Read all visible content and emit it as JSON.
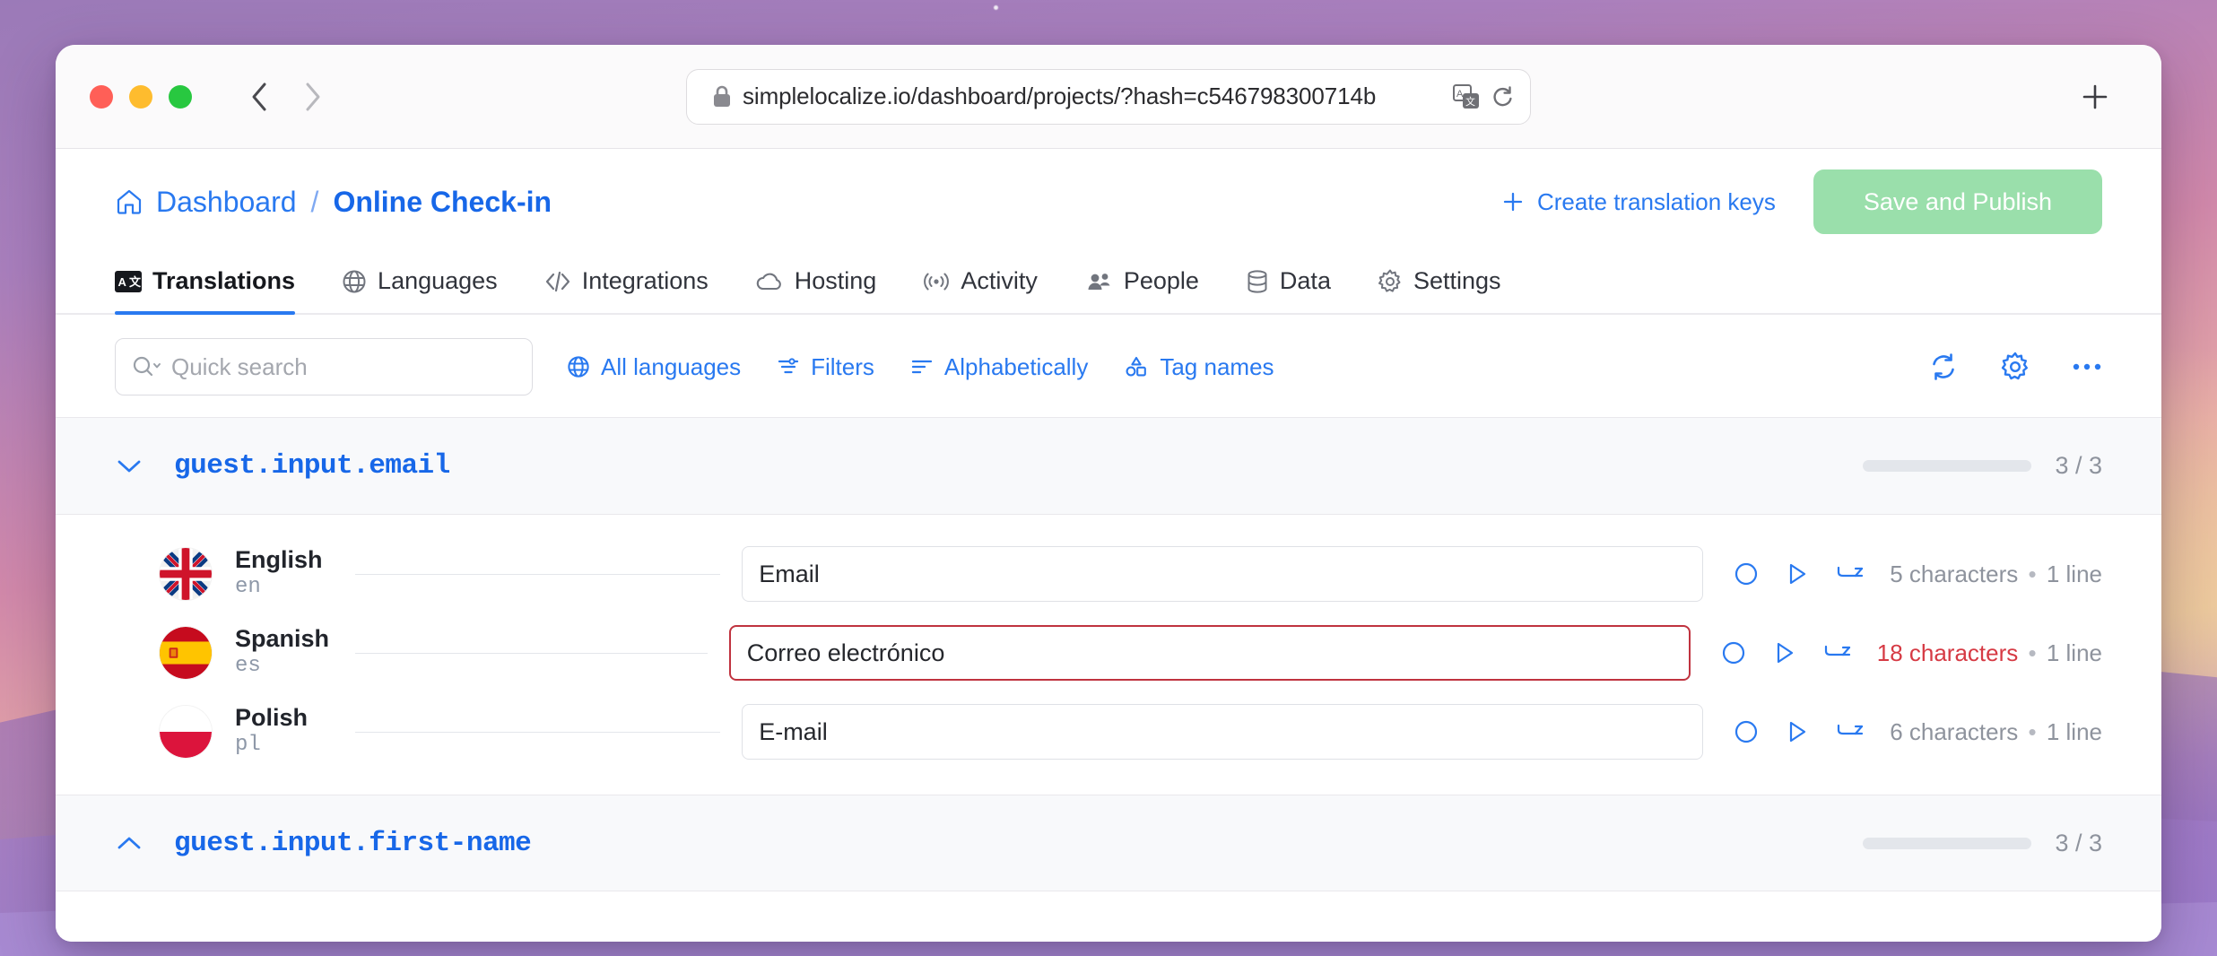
{
  "browser": {
    "url": "simplelocalize.io/dashboard/projects/?hash=c546798300714b",
    "lock_icon": "lock-icon",
    "back_icon": "back-chevron-icon",
    "forward_icon": "forward-chevron-icon",
    "translate_icon": "translate-page-icon",
    "reload_icon": "reload-icon",
    "new_tab_icon": "new-tab-plus-icon"
  },
  "header": {
    "home_icon": "home-icon",
    "breadcrumb_root": "Dashboard",
    "breadcrumb_separator": "/",
    "breadcrumb_current": "Online Check-in",
    "create_keys_label": "Create translation keys",
    "create_keys_icon": "plus-icon",
    "save_label": "Save and Publish",
    "save_color": "#9adfab"
  },
  "tabs": [
    {
      "label": "Translations",
      "icon": "translate-icon",
      "active": true
    },
    {
      "label": "Languages",
      "icon": "globe-icon",
      "active": false
    },
    {
      "label": "Integrations",
      "icon": "code-icon",
      "active": false
    },
    {
      "label": "Hosting",
      "icon": "cloud-icon",
      "active": false
    },
    {
      "label": "Activity",
      "icon": "broadcast-icon",
      "active": false
    },
    {
      "label": "People",
      "icon": "people-icon",
      "active": false
    },
    {
      "label": "Data",
      "icon": "database-icon",
      "active": false
    },
    {
      "label": "Settings",
      "icon": "gear-icon",
      "active": false
    }
  ],
  "toolbar": {
    "search_placeholder": "Quick search",
    "search_value": "",
    "search_icon": "search-icon",
    "search_chevron_icon": "chevron-down-icon",
    "actions": [
      {
        "label": "All languages",
        "icon": "globe-icon"
      },
      {
        "label": "Filters",
        "icon": "filter-icon"
      },
      {
        "label": "Alphabetically",
        "icon": "sort-icon"
      },
      {
        "label": "Tag names",
        "icon": "shapes-tag-icon"
      }
    ],
    "right_icons": [
      {
        "name": "refresh-icon"
      },
      {
        "name": "gear-icon"
      },
      {
        "name": "more-horizontal-icon"
      }
    ],
    "accent_color": "#2979f0"
  },
  "groups": [
    {
      "key": "guest.input.email",
      "expanded": true,
      "chevron_icon": "chevron-down-icon",
      "progress_label": "3 / 3",
      "progress_percent": 100,
      "progress_color": "#12b05a",
      "translations": [
        {
          "language": "English",
          "code": "en",
          "flag": "flag-gb",
          "value": "Email",
          "error": false,
          "char_count": "5 characters",
          "separator": "•",
          "line_count": "1 line",
          "actions": [
            "circle-icon",
            "play-icon",
            "line-break-icon"
          ]
        },
        {
          "language": "Spanish",
          "code": "es",
          "flag": "flag-es",
          "value": "Correo electrónico",
          "error": true,
          "char_count": "18 characters",
          "separator": "•",
          "line_count": "1 line",
          "actions": [
            "circle-icon",
            "play-icon",
            "line-break-icon"
          ]
        },
        {
          "language": "Polish",
          "code": "pl",
          "flag": "flag-pl",
          "value": "E-mail",
          "error": false,
          "char_count": "6 characters",
          "separator": "•",
          "line_count": "1 line",
          "actions": [
            "circle-icon",
            "play-icon",
            "line-break-icon"
          ]
        }
      ]
    },
    {
      "key": "guest.input.first-name",
      "expanded": false,
      "chevron_icon": "chevron-up-icon",
      "progress_label": "3 / 3",
      "progress_percent": 100,
      "progress_color": "#12b05a",
      "translations": []
    }
  ]
}
